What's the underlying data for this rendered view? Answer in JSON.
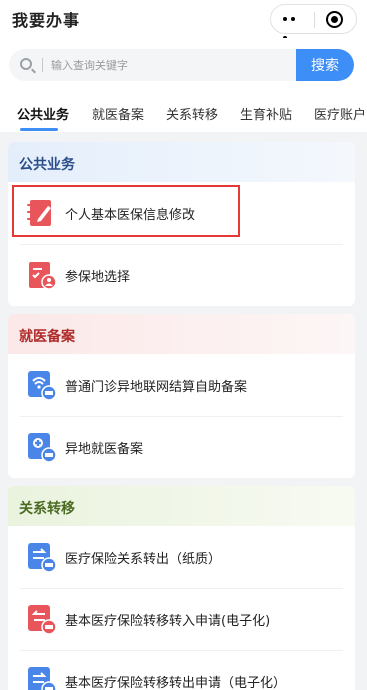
{
  "header": {
    "title": "我要办事"
  },
  "search": {
    "placeholder": "输入查询关键字",
    "button_label": "搜索"
  },
  "tabs": [
    {
      "label": "公共业务"
    },
    {
      "label": "就医备案"
    },
    {
      "label": "关系转移"
    },
    {
      "label": "生育补贴"
    },
    {
      "label": "医疗账户"
    }
  ],
  "sections": [
    {
      "title": "公共业务",
      "items": [
        {
          "label": "个人基本医保信息修改",
          "icon": "edit-notebook-icon"
        },
        {
          "label": "参保地选择",
          "icon": "insured-place-icon"
        }
      ]
    },
    {
      "title": "就医备案",
      "items": [
        {
          "label": "普通门诊异地联网结算自助备案",
          "icon": "wifi-record-icon"
        },
        {
          "label": "异地就医备案",
          "icon": "medical-record-icon"
        }
      ]
    },
    {
      "title": "关系转移",
      "items": [
        {
          "label": "医疗保险关系转出（纸质）",
          "icon": "transfer-out-icon"
        },
        {
          "label": "基本医疗保险转移转入申请(电子化)",
          "icon": "transfer-in-icon"
        },
        {
          "label": "基本医疗保险转移转出申请（电子化）",
          "icon": "transfer-out-icon"
        }
      ]
    }
  ],
  "colors": {
    "accent": "#3e8ef7",
    "highlight": "#e53935",
    "icon_red": "#e8555a",
    "icon_blue": "#4a86e8"
  }
}
